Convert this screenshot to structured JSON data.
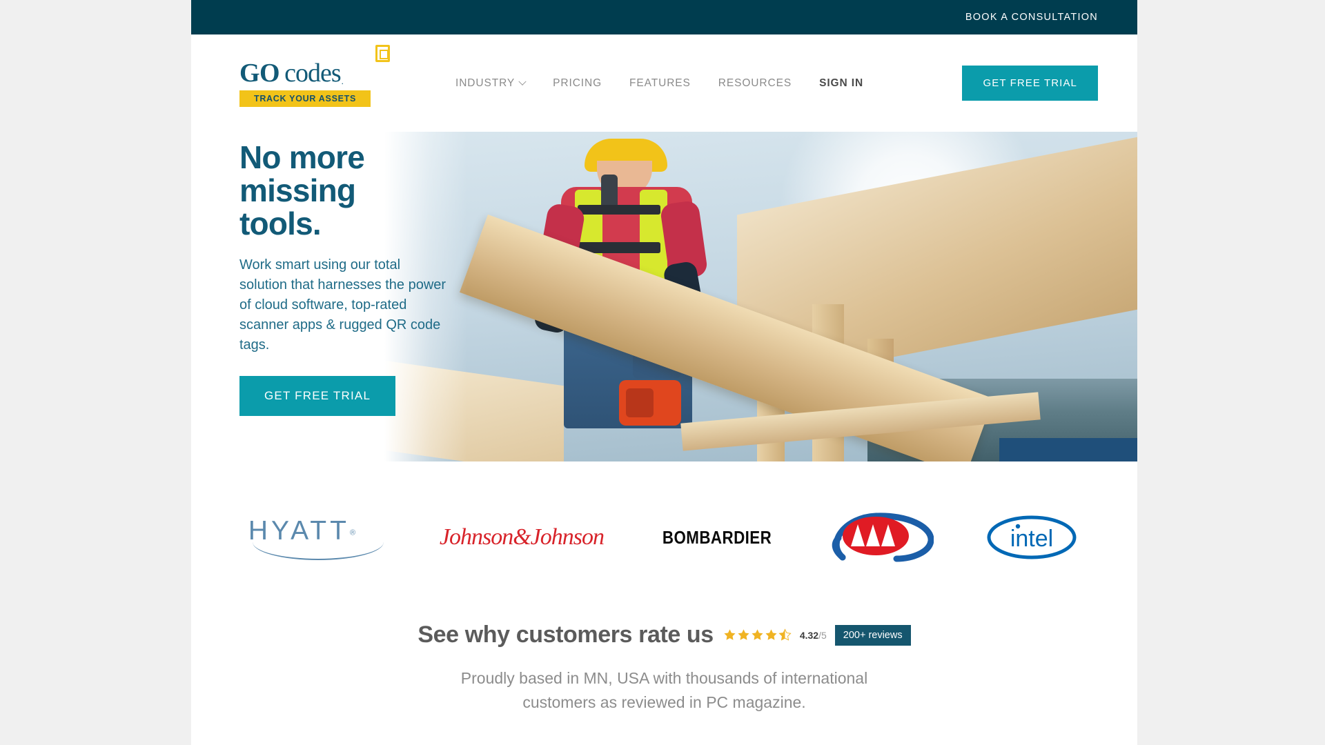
{
  "topbar": {
    "consultation_label": "BOOK A CONSULTATION"
  },
  "brand": {
    "logo_go": "GO",
    "logo_codes": "codes",
    "logo_registered": ".",
    "tagline": "TRACK YOUR ASSETS"
  },
  "nav": {
    "items": [
      {
        "label": "INDUSTRY",
        "has_dropdown": true
      },
      {
        "label": "PRICING",
        "has_dropdown": false
      },
      {
        "label": "FEATURES",
        "has_dropdown": false
      },
      {
        "label": "RESOURCES",
        "has_dropdown": false
      },
      {
        "label": "SIGN IN",
        "has_dropdown": false
      }
    ],
    "cta_label": "GET FREE TRIAL"
  },
  "hero": {
    "title_line1": "No more missing",
    "title_line2": "tools.",
    "subtitle": "Work smart using our total solution that harnesses the power of cloud software, top-rated scanner apps & rugged QR code tags.",
    "cta_label": "GET FREE TRIAL"
  },
  "brands": {
    "hyatt": "HYATT",
    "hyatt_mark": "®",
    "johnson": "Johnson&Johnson",
    "bombardier": "BOMBARDIER",
    "aaa": "AAA",
    "intel": "intel"
  },
  "rating": {
    "headline": "See why customers rate us",
    "score": "4.32",
    "score_separator": "/",
    "score_max": "5",
    "reviews_badge": "200+ reviews",
    "stars_filled": 4,
    "stars_half": 1,
    "stars_total": 5,
    "subtext": "Proudly based in MN, USA with thousands of international customers as reviewed in PC magazine."
  },
  "colors": {
    "topbar_bg": "#003d4f",
    "teal_cta": "#0b9cab",
    "heading_teal": "#125a77",
    "logo_yellow": "#f2c319",
    "star_gold": "#f0b323",
    "badge_teal": "#15566e"
  }
}
